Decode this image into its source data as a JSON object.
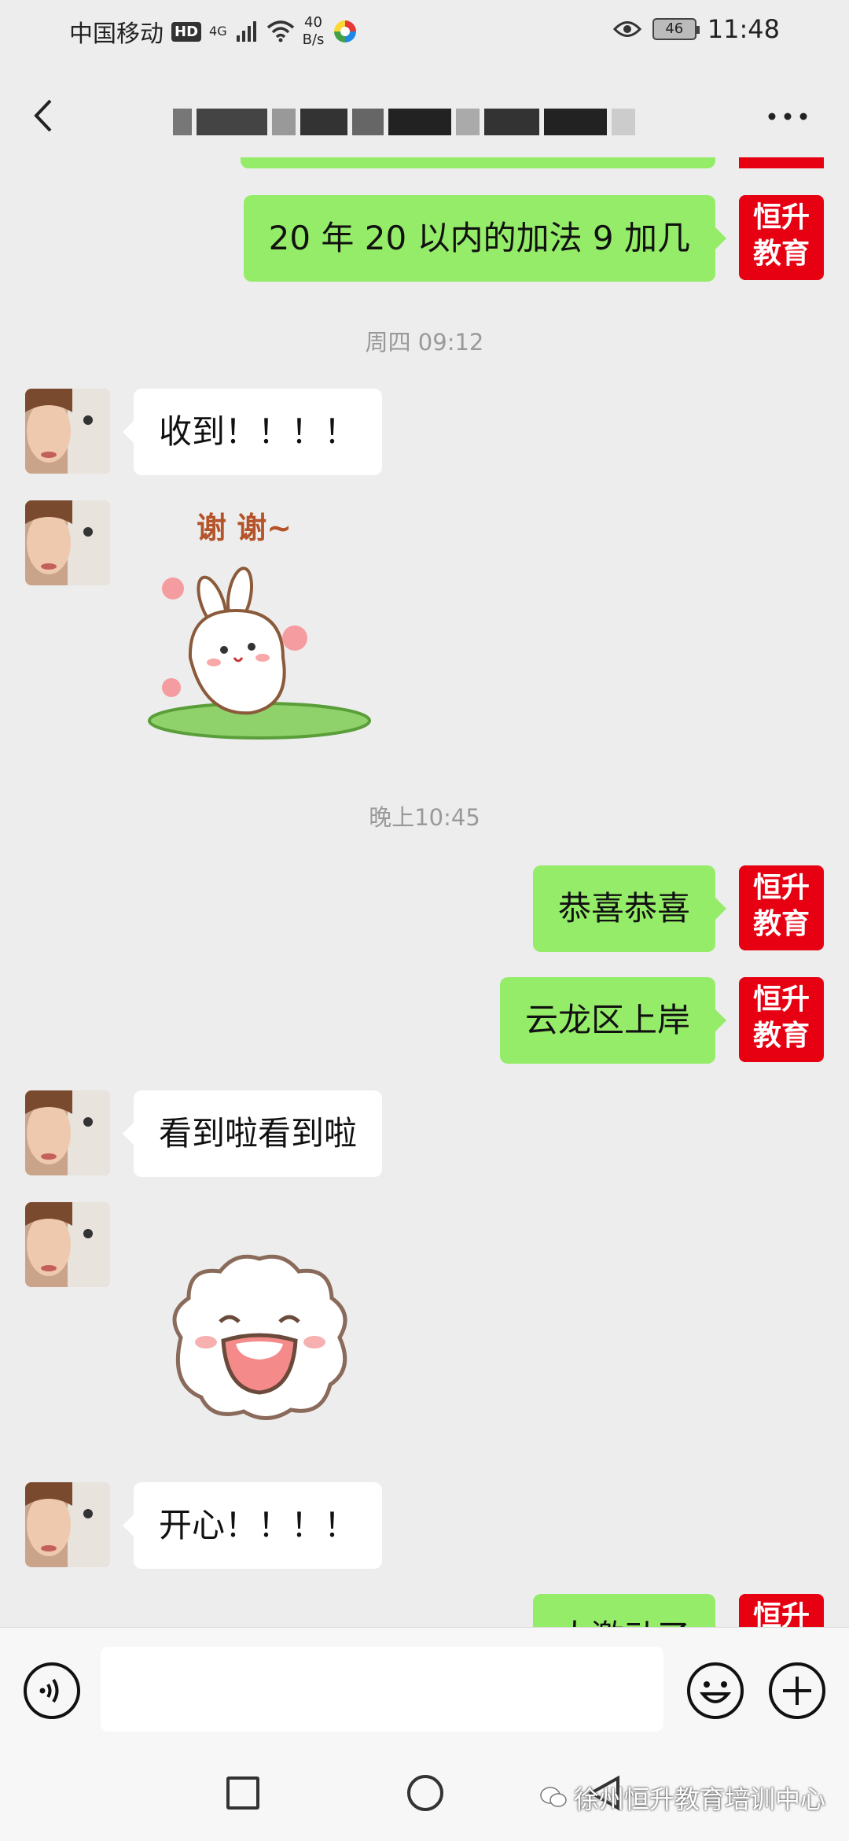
{
  "status_bar": {
    "carrier": "中国移动",
    "hd": "HD",
    "network": "4G",
    "rate_value": "40",
    "rate_unit": "B/s",
    "battery": "46",
    "time": "11:48"
  },
  "header": {
    "title_redacted": true
  },
  "contact_badge": {
    "line1": "恒升",
    "line2": "教育"
  },
  "messages": {
    "m1": "20 年 20 以内的加法 9 加几",
    "ts1": "周四 09:12",
    "m2": "收到！！！！",
    "sticker1_text": "谢 谢~",
    "ts2": "晚上10:45",
    "m3": "恭喜恭喜",
    "m4": "云龙区上岸",
    "m5": "看到啦看到啦",
    "m6": "开心！！！！",
    "m7_partial": "太激动了"
  },
  "watermark": {
    "text": "徐州恒升教育培训中心"
  },
  "colors": {
    "background": "#ededed",
    "outgoing_bubble": "#95ec69",
    "incoming_bubble": "#ffffff",
    "brand_red": "#e60012"
  }
}
